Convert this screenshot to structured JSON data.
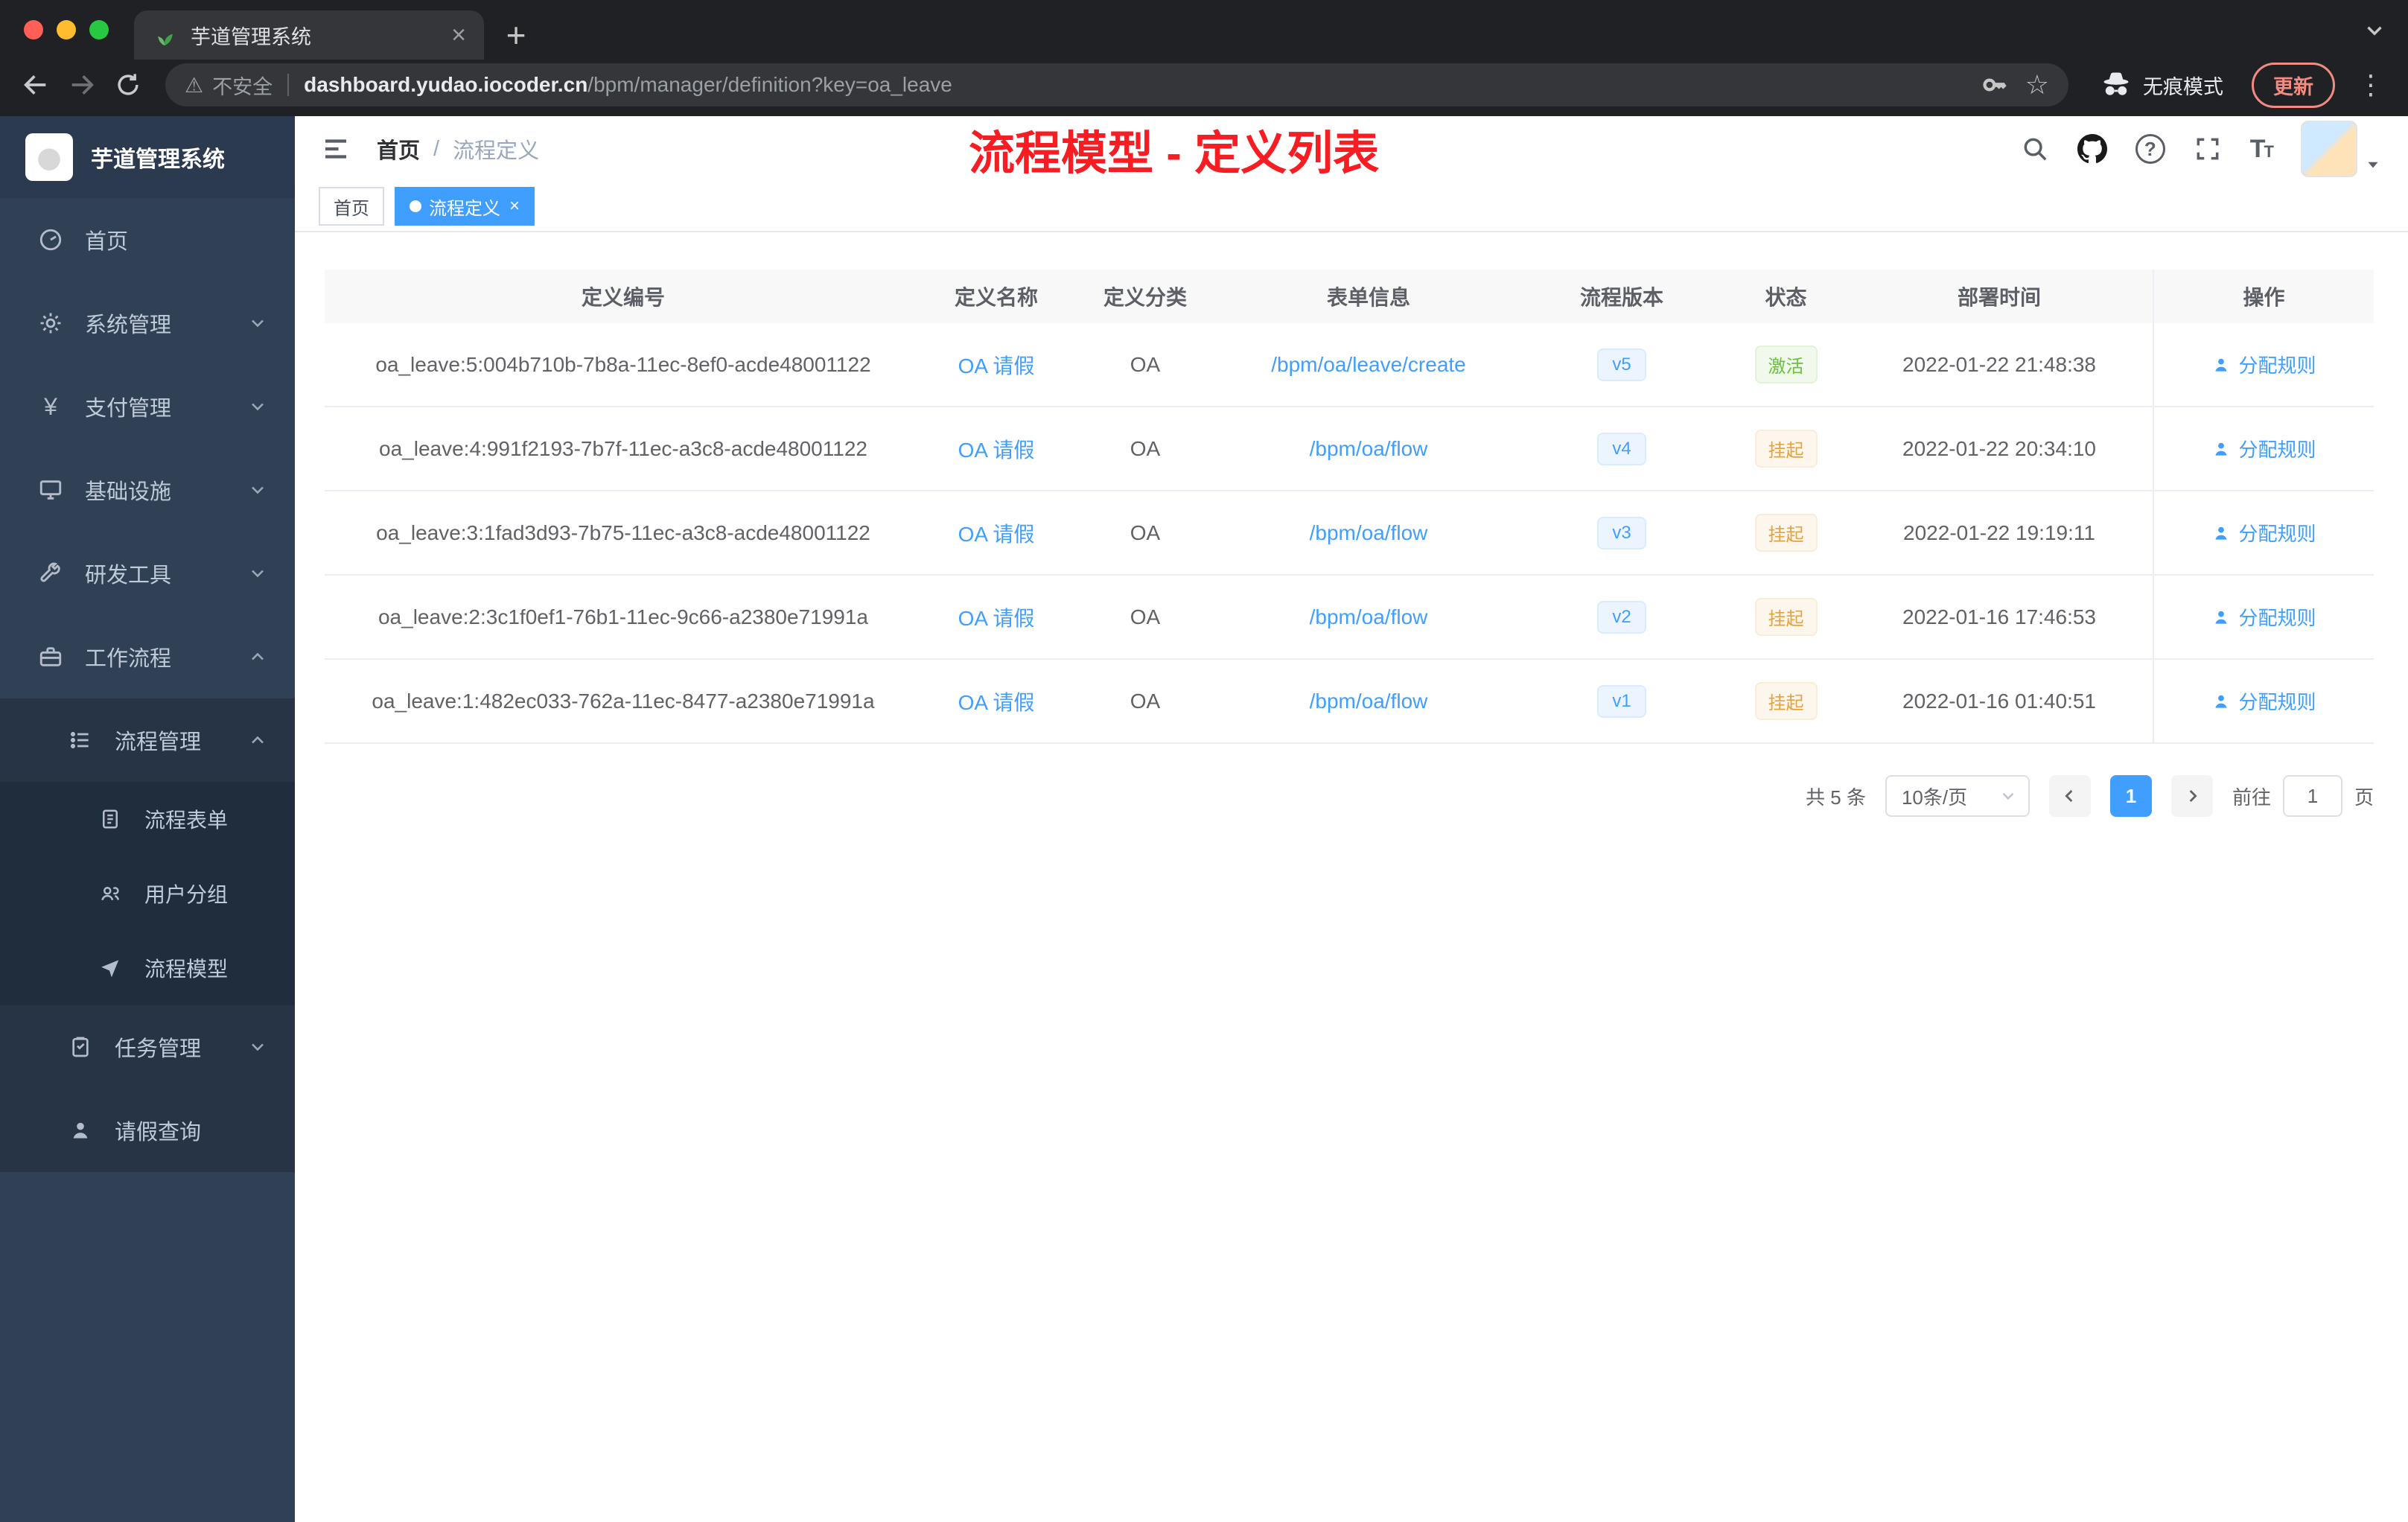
{
  "colors": {
    "accent": "#409eff",
    "annotation_red": "#f81d22",
    "sidebar_bg": "#304156"
  },
  "browser": {
    "tab_title": "芋道管理系统",
    "security_label": "不安全",
    "url_host": "dashboard.yudao.iocoder.cn",
    "url_path": "/bpm/manager/definition?key=oa_leave",
    "incognito_label": "无痕模式",
    "update_label": "更新"
  },
  "sidebar": {
    "logo_title": "芋道管理系统",
    "items": [
      {
        "label": "首页"
      },
      {
        "label": "系统管理"
      },
      {
        "label": "支付管理"
      },
      {
        "label": "基础设施"
      },
      {
        "label": "研发工具"
      },
      {
        "label": "工作流程"
      },
      {
        "label": "流程管理"
      },
      {
        "label": "流程表单"
      },
      {
        "label": "用户分组"
      },
      {
        "label": "流程模型"
      },
      {
        "label": "任务管理"
      },
      {
        "label": "请假查询"
      }
    ]
  },
  "navbar": {
    "breadcrumb_home": "首页",
    "breadcrumb_sep": "/",
    "breadcrumb_current": "流程定义",
    "annotation": "流程模型 - 定义列表"
  },
  "tags": {
    "home": "首页",
    "current": "流程定义"
  },
  "table": {
    "headers": [
      "定义编号",
      "定义名称",
      "定义分类",
      "表单信息",
      "流程版本",
      "状态",
      "部署时间",
      "操作"
    ],
    "rows": [
      {
        "id": "oa_leave:5:004b710b-7b8a-11ec-8ef0-acde48001122",
        "name": "OA 请假",
        "category": "OA",
        "form": "/bpm/oa/leave/create",
        "version": "v5",
        "status": "激活",
        "time": "2022-01-22 21:48:38",
        "action": "分配规则"
      },
      {
        "id": "oa_leave:4:991f2193-7b7f-11ec-a3c8-acde48001122",
        "name": "OA 请假",
        "category": "OA",
        "form": "/bpm/oa/flow",
        "version": "v4",
        "status": "挂起",
        "time": "2022-01-22 20:34:10",
        "action": "分配规则"
      },
      {
        "id": "oa_leave:3:1fad3d93-7b75-11ec-a3c8-acde48001122",
        "name": "OA 请假",
        "category": "OA",
        "form": "/bpm/oa/flow",
        "version": "v3",
        "status": "挂起",
        "time": "2022-01-22 19:19:11",
        "action": "分配规则"
      },
      {
        "id": "oa_leave:2:3c1f0ef1-76b1-11ec-9c66-a2380e71991a",
        "name": "OA 请假",
        "category": "OA",
        "form": "/bpm/oa/flow",
        "version": "v2",
        "status": "挂起",
        "time": "2022-01-16 17:46:53",
        "action": "分配规则"
      },
      {
        "id": "oa_leave:1:482ec033-762a-11ec-8477-a2380e71991a",
        "name": "OA 请假",
        "category": "OA",
        "form": "/bpm/oa/flow",
        "version": "v1",
        "status": "挂起",
        "time": "2022-01-16 01:40:51",
        "action": "分配规则"
      }
    ]
  },
  "pagination": {
    "total": "共 5 条",
    "page_size": "10条/页",
    "current_page": "1",
    "goto_label": "前往",
    "goto_value": "1",
    "unit_label": "页"
  }
}
